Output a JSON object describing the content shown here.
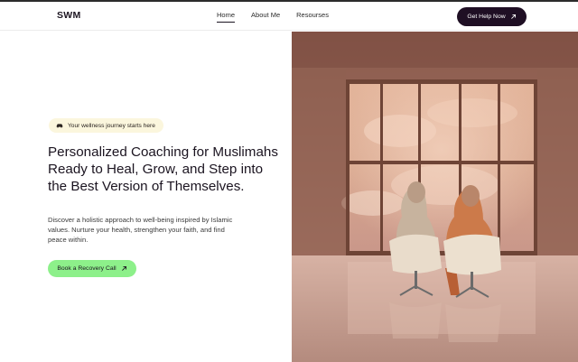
{
  "header": {
    "logo": "SWM",
    "nav": [
      {
        "label": "Home",
        "active": true
      },
      {
        "label": "About Me",
        "active": false
      },
      {
        "label": "Resourses",
        "active": false
      }
    ],
    "cta_label": "Get Help Now",
    "cta_icon": "arrow-up-right-icon"
  },
  "hero": {
    "badge_icon": "car-icon",
    "badge_text": "Your wellness journey starts here",
    "headline": "Personalized Coaching for Muslimahs Ready to Heal, Grow, and Step into the Best Version of Themselves.",
    "description": "Discover a holistic approach to well-being inspired by Islamic values. Nurture your health, strengthen your faith, and find peace within.",
    "cta_label": "Book a Recovery Call",
    "cta_icon": "arrow-up-right-icon"
  },
  "colors": {
    "primary_dark": "#1f0f24",
    "accent_green": "#8df08a",
    "badge_bg": "#fbf6dd"
  }
}
